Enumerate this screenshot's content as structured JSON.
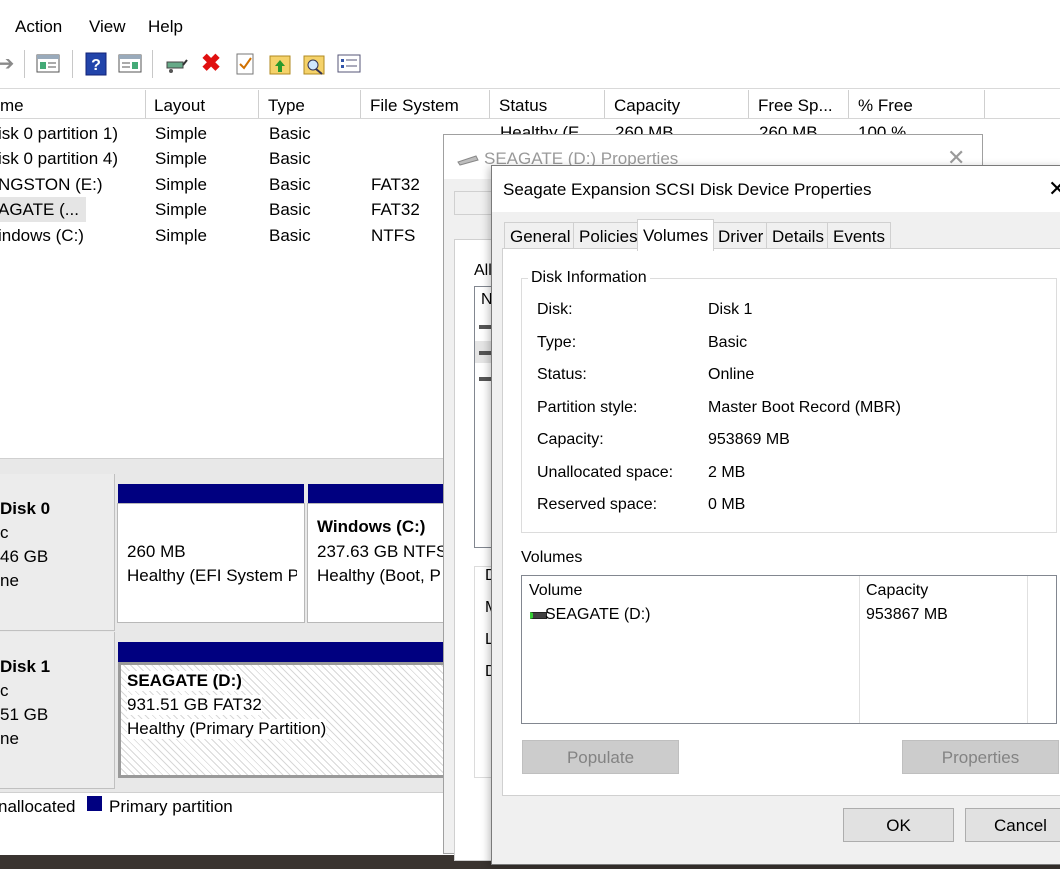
{
  "menu": [
    "Action",
    "View",
    "Help"
  ],
  "columns": [
    "me",
    "Layout",
    "Type",
    "File System",
    "Status",
    "Capacity",
    "Free Sp...",
    "% Free"
  ],
  "volumes": [
    {
      "name": "isk 0 partition 1)",
      "layout": "Simple",
      "type": "Basic",
      "fs": "",
      "status": "Healthy (E",
      "capacity": "260 MB",
      "free": "260 MB",
      "pct": "100 %"
    },
    {
      "name": "isk 0 partition 4)",
      "layout": "Simple",
      "type": "Basic",
      "fs": ""
    },
    {
      "name": "NGSTON (E:)",
      "layout": "Simple",
      "type": "Basic",
      "fs": "FAT32"
    },
    {
      "name": "AGATE (...",
      "layout": "Simple",
      "type": "Basic",
      "fs": "FAT32"
    },
    {
      "name": "indows (C:)",
      "layout": "Simple",
      "type": "Basic",
      "fs": "NTFS"
    }
  ],
  "disk0": {
    "label": "Disk 0",
    "line2": "c",
    "line3": "46 GB",
    "line4": "ne",
    "p1": {
      "size": "260 MB",
      "status": "Healthy (EFI System P"
    },
    "p2": {
      "name": "Windows  (C:)",
      "size": "237.63 GB NTFS",
      "status": "Healthy (Boot, P"
    }
  },
  "disk1": {
    "label": "Disk 1",
    "line2": "c",
    "line3": "51 GB",
    "line4": "ne",
    "p1": {
      "name": "SEAGATE  (D:)",
      "size": "931.51 GB FAT32",
      "status": "Healthy (Primary Partition)"
    }
  },
  "legend": {
    "unallocated": "nallocated",
    "primary": "Primary partition"
  },
  "seaprops": {
    "title": "SEAGATE (D:) Properties",
    "frag_all": "All",
    "frag_n": "N",
    "frag_d1": "D",
    "frag_m": "M",
    "frag_l": "L",
    "frag_d2": "D"
  },
  "dialog": {
    "title": "Seagate Expansion SCSI Disk Device Properties",
    "tabs": [
      "General",
      "Policies",
      "Volumes",
      "Driver",
      "Details",
      "Events"
    ],
    "active_tab": "Volumes",
    "group_title": "Disk Information",
    "info": [
      {
        "label": "Disk:",
        "value": "Disk 1"
      },
      {
        "label": "Type:",
        "value": "Basic"
      },
      {
        "label": "Status:",
        "value": "Online"
      },
      {
        "label": "Partition style:",
        "value": "Master Boot Record (MBR)"
      },
      {
        "label": "Capacity:",
        "value": "953869 MB"
      },
      {
        "label": "Unallocated space:",
        "value": "2 MB"
      },
      {
        "label": "Reserved space:",
        "value": "0 MB"
      }
    ],
    "volumes_label": "Volumes",
    "vol_header": {
      "volume": "Volume",
      "capacity": "Capacity"
    },
    "vol_rows": [
      {
        "volume": "SEAGATE (D:)",
        "capacity": "953867 MB"
      }
    ],
    "populate": "Populate",
    "properties": "Properties",
    "ok": "OK",
    "cancel": "Cancel"
  },
  "colors": {
    "primary_partition": "#000080",
    "disabled_button": "#cccccc"
  }
}
